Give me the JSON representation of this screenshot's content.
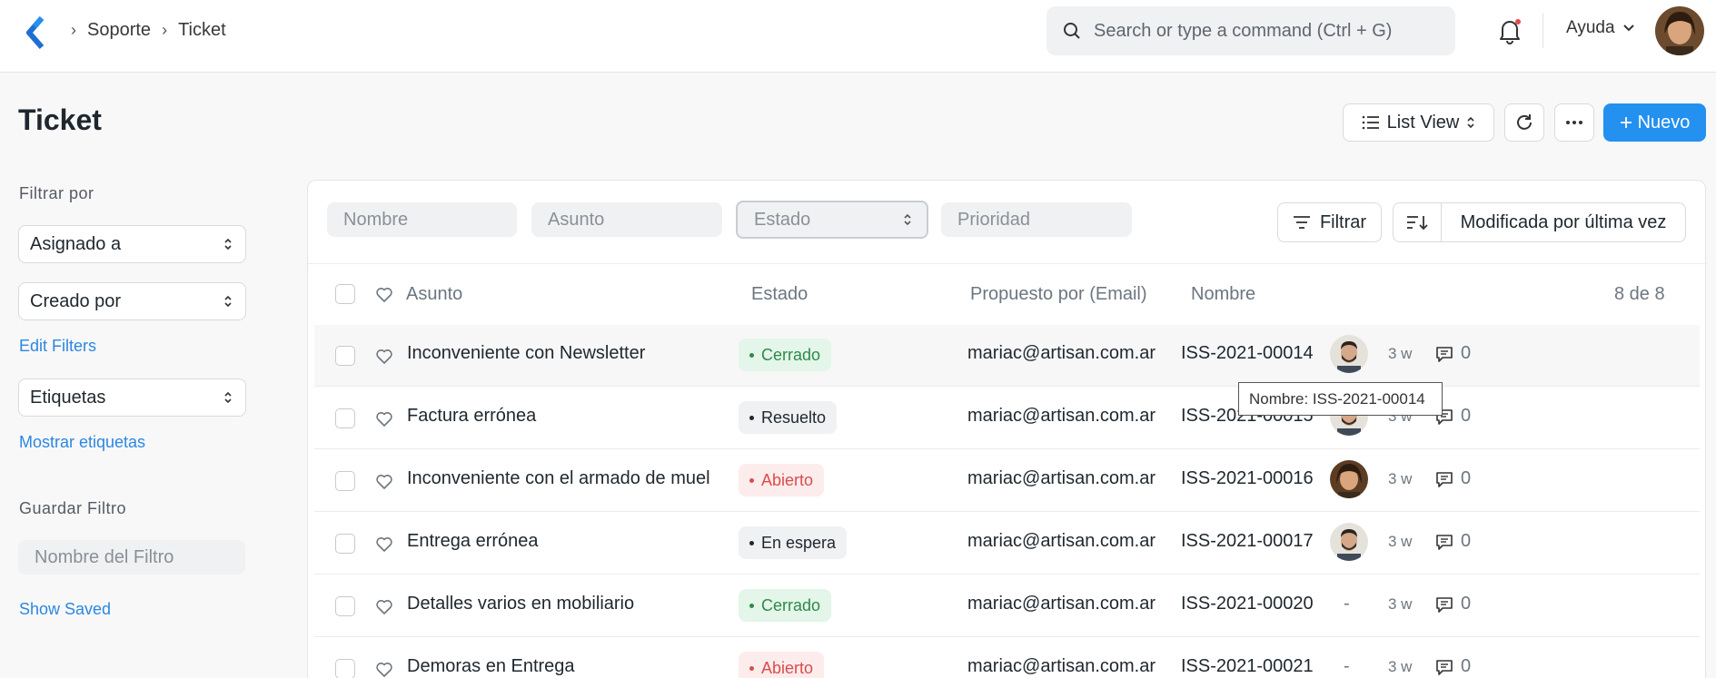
{
  "breadcrumb": {
    "items": [
      "Soporte",
      "Ticket"
    ]
  },
  "search": {
    "placeholder": "Search or type a command (Ctrl + G)"
  },
  "help": {
    "label": "Ayuda"
  },
  "page": {
    "title": "Ticket"
  },
  "toolbar": {
    "view_label": "List View",
    "new_label": "Nuevo"
  },
  "sidebar": {
    "filter_by_label": "Filtrar por",
    "assigned_to": "Asignado a",
    "created_by": "Creado por",
    "edit_filters": "Edit Filters",
    "tags": "Etiquetas",
    "show_tags": "Mostrar etiquetas",
    "save_filter_label": "Guardar Filtro",
    "filter_name_placeholder": "Nombre del Filtro",
    "show_saved": "Show Saved"
  },
  "filters": {
    "name_placeholder": "Nombre",
    "subject_placeholder": "Asunto",
    "status_placeholder": "Estado",
    "priority_placeholder": "Prioridad",
    "filter_label": "Filtrar",
    "sort_label": "Modificada por última vez"
  },
  "table": {
    "headers": {
      "subject": "Asunto",
      "status": "Estado",
      "raised_by": "Propuesto por (Email)",
      "name": "Nombre",
      "count": "8 de 8"
    },
    "rows": [
      {
        "subject": "Inconveniente con Newsletter",
        "status": "Cerrado",
        "email": "mariac@artisan.com.ar",
        "name": "ISS-2021-00014",
        "time": "3 w",
        "comments": "0"
      },
      {
        "subject": "Factura errónea",
        "status": "Resuelto",
        "email": "mariac@artisan.com.ar",
        "name": "ISS-2021-00015",
        "time": "3 w",
        "comments": "0"
      },
      {
        "subject": "Inconveniente con el armado de muel",
        "status": "Abierto",
        "email": "mariac@artisan.com.ar",
        "name": "ISS-2021-00016",
        "time": "3 w",
        "comments": "0"
      },
      {
        "subject": "Entrega errónea",
        "status": "En espera",
        "email": "mariac@artisan.com.ar",
        "name": "ISS-2021-00017",
        "time": "3 w",
        "comments": "0"
      },
      {
        "subject": "Detalles varios en mobiliario",
        "status": "Cerrado",
        "email": "mariac@artisan.com.ar",
        "name": "ISS-2021-00020",
        "assignee": "-",
        "time": "3 w",
        "comments": "0"
      },
      {
        "subject": "Demoras en Entrega",
        "status": "Abierto",
        "email": "mariac@artisan.com.ar",
        "name": "ISS-2021-00021",
        "assignee": "-",
        "time": "3 w",
        "comments": "0"
      }
    ]
  },
  "tooltip": {
    "text": "Nombre: ISS-2021-00014"
  },
  "colors": {
    "primary": "#2490ef",
    "closed": "#2f8a4a",
    "open": "#d94c4c",
    "link": "#2c87e0"
  }
}
